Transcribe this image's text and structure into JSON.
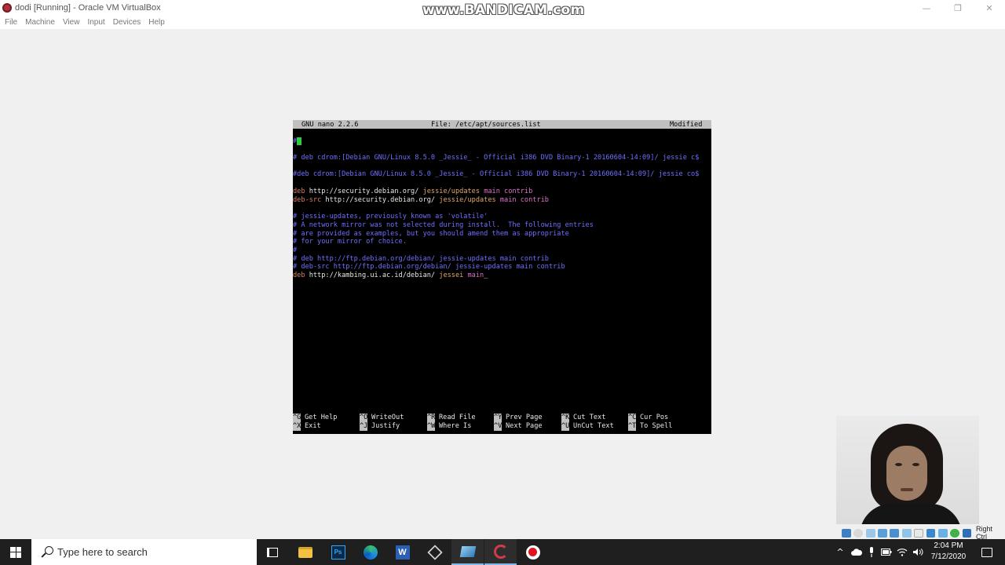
{
  "window": {
    "title": "dodi [Running] - Oracle VM VirtualBox",
    "watermark": "www.BANDICAM.com",
    "controls": {
      "minimize": "—",
      "restore": "❐",
      "close": "✕"
    }
  },
  "menu": [
    "File",
    "Machine",
    "View",
    "Input",
    "Devices",
    "Help"
  ],
  "nano": {
    "version": "GNU nano 2.2.6",
    "file": "File: /etc/apt/sources.list",
    "status": "Modified",
    "lines": {
      "l1_hash": "#",
      "l2": "# deb cdrom:[Debian GNU/Linux 8.5.0 _Jessie_ - Official i386 DVD Binary-1 20160604-14:09]/ jessie c$",
      "l3": "#deb cdrom:[Debian GNU/Linux 8.5.0 _Jessie_ - Official i386 DVD Binary-1 20160604-14:09]/ jessie co$",
      "l4_deb": "deb",
      "l4_url": " http://security.debian.org/",
      "l4_dist": " jessie/updates",
      "l4_comp": " main contrib",
      "l5_deb": "deb-src",
      "l5_url": " http://security.debian.org/",
      "l5_dist": " jessie/updates",
      "l5_comp": " main contrib",
      "l6": "# jessie-updates, previously known as 'volatile'",
      "l7": "# A network mirror was not selected during install.  The following entries",
      "l8": "# are provided as examples, but you should amend them as appropriate",
      "l9": "# for your mirror of choice.",
      "l10": "#",
      "l11": "# deb http://ftp.debian.org/debian/ jessie-updates main contrib",
      "l12": "# deb-src http://ftp.debian.org/debian/ jessie-updates main contrib",
      "l13_deb": "deb",
      "l13_url": " http://kambing.ui.ac.id/debian/",
      "l13_dist": " jessei",
      "l13_comp": " main",
      "l13_cursor": "_"
    },
    "shortcuts_row1": [
      {
        "key": "^G",
        "label": "Get Help"
      },
      {
        "key": "^O",
        "label": "WriteOut"
      },
      {
        "key": "^R",
        "label": "Read File"
      },
      {
        "key": "^Y",
        "label": "Prev Page"
      },
      {
        "key": "^K",
        "label": "Cut Text"
      },
      {
        "key": "^C",
        "label": "Cur Pos"
      }
    ],
    "shortcuts_row2": [
      {
        "key": "^X",
        "label": "Exit"
      },
      {
        "key": "^J",
        "label": "Justify"
      },
      {
        "key": "^W",
        "label": "Where Is"
      },
      {
        "key": "^V",
        "label": "Next Page"
      },
      {
        "key": "^U",
        "label": "UnCut Text"
      },
      {
        "key": "^T",
        "label": "To Spell"
      }
    ]
  },
  "vbox_status": {
    "host_key": "Right Ctrl"
  },
  "taskbar": {
    "search_placeholder": "Type here to search",
    "ps_label": "Ps",
    "word_label": "W",
    "time": "2:04 PM",
    "date": "7/12/2020",
    "tray_chevron": "^"
  },
  "colors": {
    "comment": "#6f6fff",
    "deb": "#d87a62",
    "dist": "#e0a868",
    "component": "#e070c8",
    "cursor": "#2ecc40"
  }
}
